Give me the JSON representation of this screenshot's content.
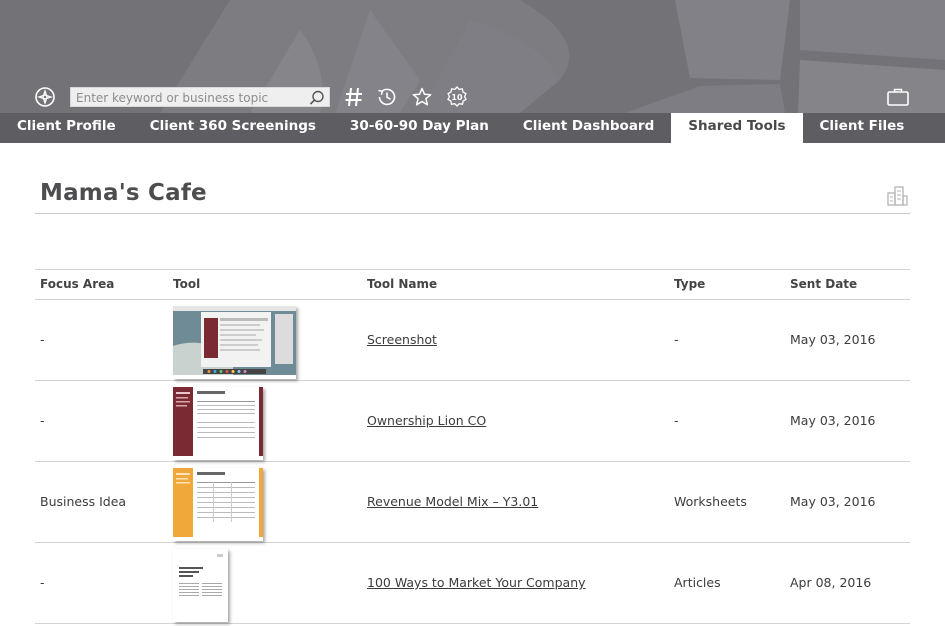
{
  "search": {
    "placeholder": "Enter keyword or business topic"
  },
  "toolbar_icons": [
    "compass-icon",
    "search-icon",
    "hashtag-icon",
    "history-icon",
    "star-icon",
    "badge-10-icon",
    "briefcase-icon"
  ],
  "tabs": [
    {
      "label": "Client Profile",
      "active": false
    },
    {
      "label": "Client 360 Screenings",
      "active": false
    },
    {
      "label": "30-60-90 Day Plan",
      "active": false
    },
    {
      "label": "Client Dashboard",
      "active": false
    },
    {
      "label": "Shared Tools",
      "active": true
    },
    {
      "label": "Client Files",
      "active": false
    }
  ],
  "page": {
    "title": "Mama's Cafe"
  },
  "table": {
    "headers": [
      "Focus Area",
      "Tool",
      "Tool Name",
      "Type",
      "Sent Date"
    ],
    "rows": [
      {
        "focus_area": "-",
        "tool_thumb": "screenshot-thumbnail",
        "tool_name": "Screenshot",
        "type": "-",
        "sent_date": "May 03, 2016"
      },
      {
        "focus_area": "-",
        "tool_thumb": "ownership-document-thumbnail",
        "tool_name": "Ownership Lion CO",
        "type": "-",
        "sent_date": "May 03, 2016"
      },
      {
        "focus_area": "Business Idea",
        "tool_thumb": "revenue-worksheet-thumbnail",
        "tool_name": "Revenue Model Mix – Y3.01",
        "type": "Worksheets",
        "sent_date": "May 03, 2016"
      },
      {
        "focus_area": "-",
        "tool_thumb": "article-thumbnail",
        "tool_name": "100 Ways to Market Your Company",
        "type": "Articles",
        "sent_date": "Apr 08, 2016"
      }
    ]
  },
  "colors": {
    "header_bg": "#737277",
    "tabs_bg": "#5d5d62",
    "accent_maroon": "#7a2a33",
    "accent_orange": "#f0a83a"
  }
}
